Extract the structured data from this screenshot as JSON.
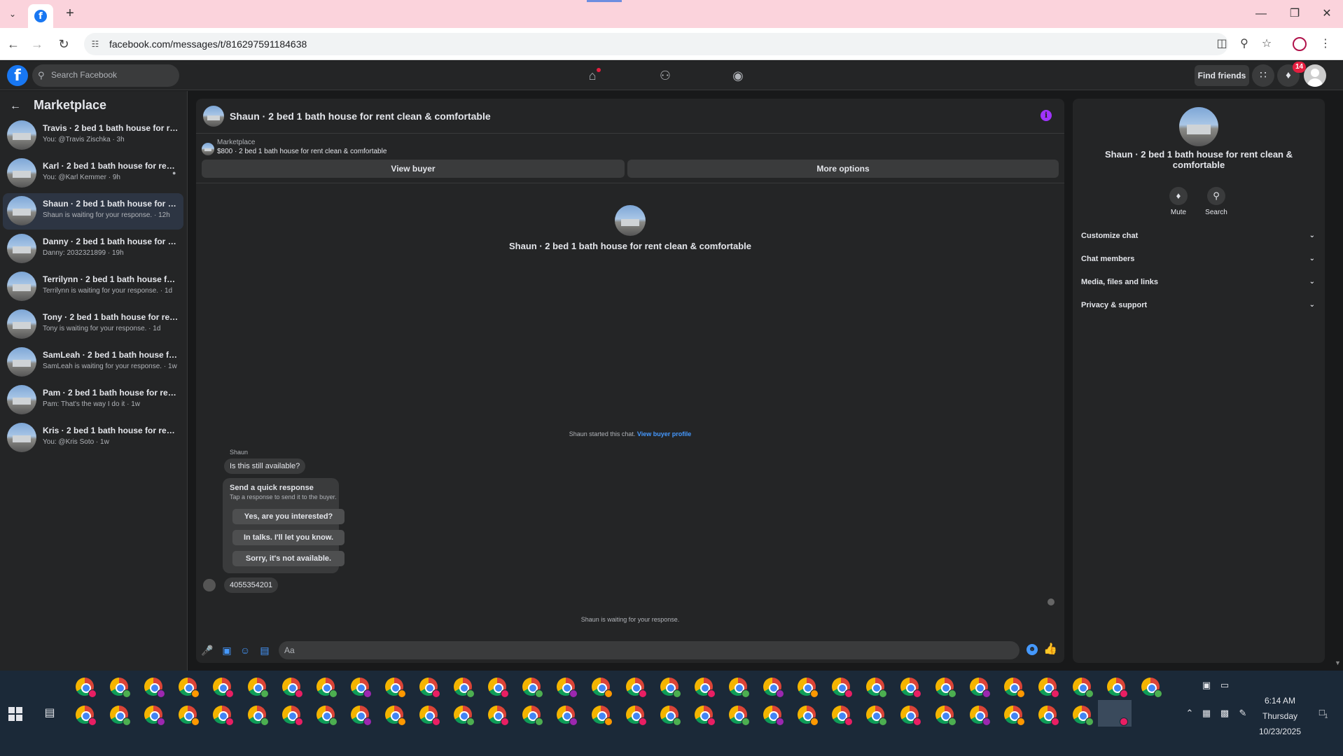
{
  "browser": {
    "url": "facebook.com/messages/t/816297591184638",
    "tab_list_icon": "chevron-down-icon",
    "new_tab_icon": "plus-icon"
  },
  "fb_header": {
    "search_placeholder": "Search Facebook",
    "find_friends_label": "Find friends",
    "notification_count": "14",
    "logo_letter": "f"
  },
  "sidebar": {
    "title": "Marketplace",
    "conversations": [
      {
        "title": "Travis · 2 bed 1 bath house for rent...",
        "subtitle": "You: @Travis Zischka · 3h"
      },
      {
        "title": "Karl · 2 bed 1 bath house for ren...",
        "subtitle": "You: @Karl Kemmer · 9h"
      },
      {
        "title": "Shaun · 2 bed 1 bath house for ren...",
        "subtitle": "Shaun is waiting for your response. · 12h"
      },
      {
        "title": "Danny · 2 bed 1 bath house for ren...",
        "subtitle": "Danny: 2032321899 · 19h"
      },
      {
        "title": "Terrilynn · 2 bed 1 bath house for r...",
        "subtitle": "Terrilynn is waiting for your response. · 1d"
      },
      {
        "title": "Tony · 2 bed 1 bath house for rent ...",
        "subtitle": "Tony is waiting for your response. · 1d"
      },
      {
        "title": "SamLeah · 2 bed 1 bath house for r...",
        "subtitle": "SamLeah is waiting for your response. · 1w"
      },
      {
        "title": "Pam · 2 bed 1 bath house for rent ...",
        "subtitle": "Pam: That's the way I do it · 1w"
      },
      {
        "title": "Kris · 2 bed 1 bath house for rent c...",
        "subtitle": "You: @Kris Soto · 1w"
      }
    ]
  },
  "chat": {
    "title": "Shaun · 2 bed 1 bath house for rent clean & comfortable",
    "marketplace_label": "Marketplace",
    "listing": "$800 · 2 bed 1 bath house for rent clean & comfortable",
    "view_buyer_label": "View buyer",
    "more_options_label": "More options",
    "center_title": "Shaun · 2 bed 1 bath house for rent clean & comfortable",
    "started_text": "Shaun started this chat.",
    "view_buyer_profile": "View buyer profile",
    "sender_name": "Shaun",
    "first_message": "Is this still available?",
    "quick_response_title": "Send a quick response",
    "quick_response_sub": "Tap a response to send it to the buyer.",
    "quick_responses": [
      "Yes, are you interested?",
      "In talks. I'll let you know.",
      "Sorry, it's not available."
    ],
    "phone_message": "4055354201",
    "waiting_text": "Shaun is waiting for your response.",
    "composer_placeholder": "Aa"
  },
  "info_panel": {
    "title": "Shaun · 2 bed 1 bath house for rent clean & comfortable",
    "mute_label": "Mute",
    "search_label": "Search",
    "sections": [
      "Customize chat",
      "Chat members",
      "Media, files and links",
      "Privacy & support"
    ]
  },
  "taskbar": {
    "time": "6:14 AM",
    "day": "Thursday",
    "date": "10/23/2025",
    "notification_count": "1"
  },
  "colors": {
    "accent": "#1877f2",
    "link": "#4599ff",
    "info_icon": "#a033ff",
    "badge": "#e41e3f"
  }
}
